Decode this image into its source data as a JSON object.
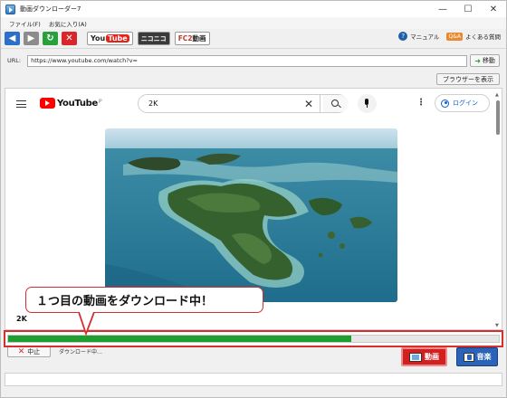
{
  "window": {
    "title": "動画ダウンローダー7",
    "minimize": "—",
    "maximize": "☐",
    "close": "✕"
  },
  "menu": [
    "ファイル(F)",
    "お気に入り(A)"
  ],
  "toolbar": {
    "back": "◀",
    "forward": "▶",
    "refresh": "↻",
    "stop": "✕",
    "sites": {
      "youtube_you": "You",
      "youtube_tube": "Tube",
      "niconico": "ニコニコ",
      "fc2": "FC2",
      "fc2_douga": "動画"
    },
    "manual": "マニュアル",
    "faq_badge": "Q&A",
    "faq": "よくある質問"
  },
  "url": {
    "label": "URL:",
    "value": "https://www.youtube.com/watch?v=",
    "go": "移動"
  },
  "browser_button": "ブラウザーを表示",
  "youtube": {
    "logo": "YouTube",
    "logo_region": "JP",
    "search_value": "2K",
    "clear": "✕",
    "more": "⋮",
    "login": "ログイン",
    "video_title": "2K"
  },
  "callout": "１つ目の動画をダウンロード中！",
  "progress": {
    "fraction": 0.7
  },
  "status": {
    "stop": "中止",
    "stop_icon": "✕",
    "text": "ダウンロード中…"
  },
  "mode": {
    "video": "動画",
    "audio": "音楽"
  },
  "colors": {
    "accent_red": "#d42e2e",
    "progress_green": "#1e9e2e",
    "youtube_red": "#ff0000",
    "audio_blue": "#2a63b8"
  }
}
